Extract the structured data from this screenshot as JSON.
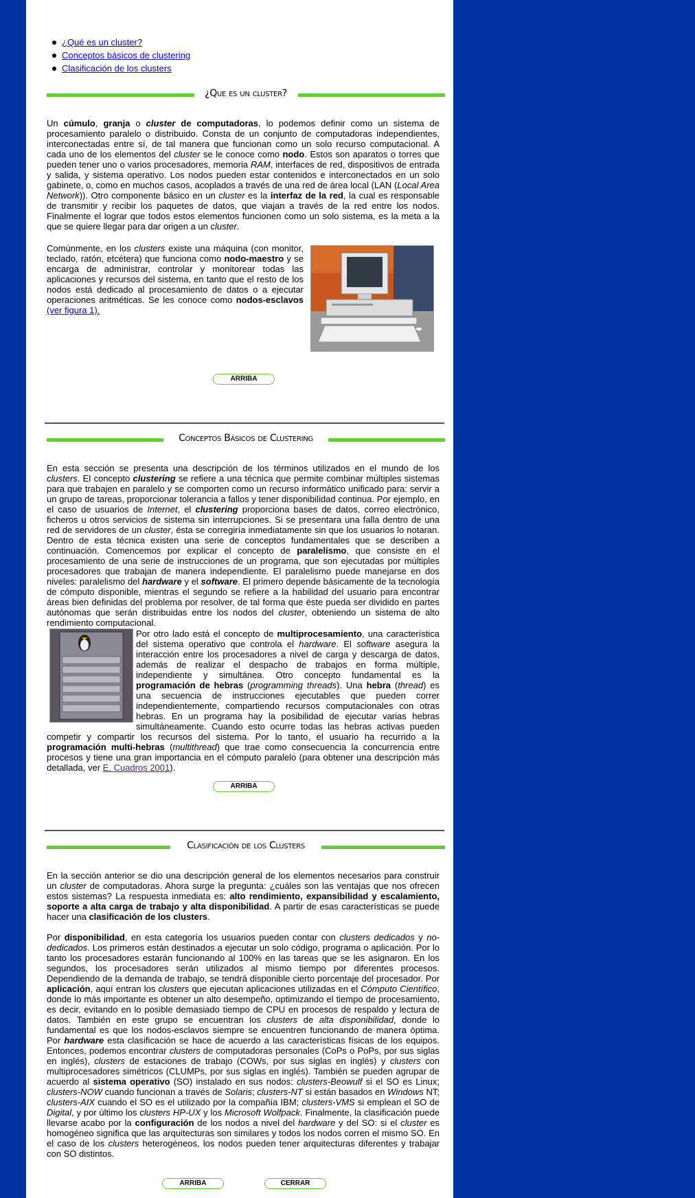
{
  "toc": [
    "¿Qué es un cluster?",
    "Conceptos básicos de clustering",
    "Clasificación de los clusters"
  ],
  "sections": {
    "s1_title": "¿Que es un cluster?",
    "s2_title": "Conceptos Básicos de Clustering",
    "s3_title": "Clasificación de los Clusters"
  },
  "buttons": {
    "arriba": "ARRIBA",
    "cerrar": "CERRAR"
  },
  "links": {
    "ver_figura": "(ver figura 1).",
    "cuadros": "E. Cuadros 2001"
  },
  "images": {
    "computer": "computer-photo",
    "rack": "server-rack-photo"
  },
  "colors": {
    "page_bg": "#0033a0",
    "accent_green": "#66cc33",
    "link": "#0000ee"
  }
}
